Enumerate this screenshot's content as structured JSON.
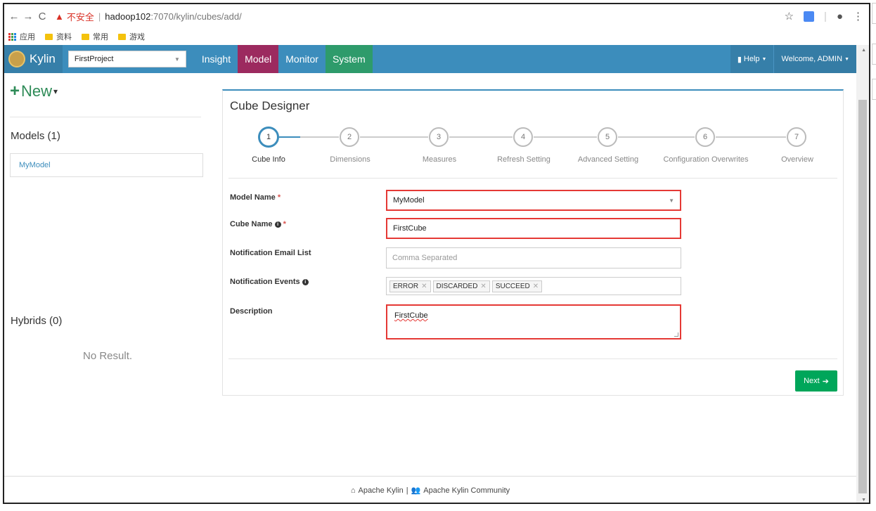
{
  "browser": {
    "insecure_label": "不安全",
    "url_host": "hadoop102",
    "url_path": ":7070/kylin/cubes/add/"
  },
  "bookmarks": [
    "应用",
    "资料",
    "常用",
    "游戏"
  ],
  "navbar": {
    "brand": "Kylin",
    "project": "FirstProject",
    "items": [
      "Insight",
      "Model",
      "Monitor",
      "System"
    ],
    "active_item": "Model",
    "help": "Help",
    "welcome": "Welcome, ADMIN"
  },
  "sidebar": {
    "new_label": "New",
    "models_title": "Models (1)",
    "models": [
      "MyModel"
    ],
    "hybrids_title": "Hybrids (0)",
    "no_result": "No Result."
  },
  "designer": {
    "title": "Cube Designer",
    "steps": [
      {
        "num": "1",
        "label": "Cube Info"
      },
      {
        "num": "2",
        "label": "Dimensions"
      },
      {
        "num": "3",
        "label": "Measures"
      },
      {
        "num": "4",
        "label": "Refresh Setting"
      },
      {
        "num": "5",
        "label": "Advanced Setting"
      },
      {
        "num": "6",
        "label": "Configuration Overwrites"
      },
      {
        "num": "7",
        "label": "Overview"
      }
    ],
    "active_step": 1,
    "form": {
      "model_name_label": "Model Name",
      "model_name_value": "MyModel",
      "cube_name_label": "Cube Name",
      "cube_name_value": "FirstCube",
      "email_label": "Notification Email List",
      "email_placeholder": "Comma Separated",
      "events_label": "Notification Events",
      "events": [
        "ERROR",
        "DISCARDED",
        "SUCCEED"
      ],
      "description_label": "Description",
      "description_value": "FirstCube"
    },
    "next_label": "Next"
  },
  "footer": {
    "link1": "Apache Kylin",
    "separator": "|",
    "link2": "Apache Kylin Community"
  },
  "colors": {
    "navbar": "#3c8dbc",
    "model_active": "#9c2a5f",
    "system": "#2e9b6b",
    "highlight": "#e53935",
    "next_button": "#00a65a"
  }
}
